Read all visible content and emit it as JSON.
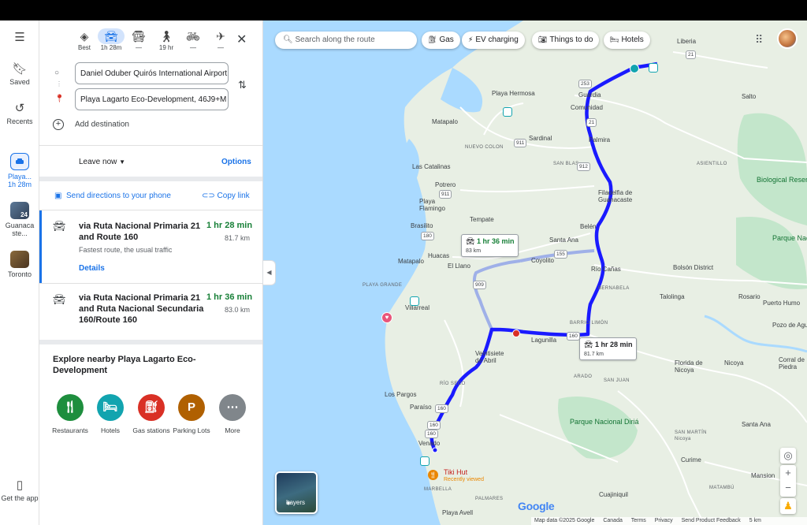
{
  "rail": {
    "menu_icon": "menu-icon",
    "saved": "Saved",
    "recents": "Recents",
    "active_label_line1": "Playa...",
    "active_label_line2": "1h 28m",
    "recent_1_label": "Guanaca ste...",
    "recent_1_count": "24",
    "recent_2_label": "Toronto",
    "get_app": "Get the app"
  },
  "modes": {
    "best": "Best",
    "drive": "1h 28m",
    "transit": "—",
    "walk": "19 hr",
    "bike": "—",
    "flight": "—"
  },
  "waypoints": {
    "origin": "Daniel Oduber Quirós International Airport",
    "destination": "Playa Lagarto Eco-Development, 46J9+M",
    "add_destination": "Add destination"
  },
  "timing": {
    "leave_now": "Leave now",
    "options": "Options"
  },
  "share": {
    "send_directions": "Send directions to your phone",
    "copy_link": "Copy link"
  },
  "routes": [
    {
      "name": "via Ruta Nacional Primaria 21 and Route 160",
      "duration": "1 hr 28 min",
      "distance": "81.7 km",
      "description": "Fastest route, the usual traffic",
      "details": "Details"
    },
    {
      "name": "via Ruta Nacional Primaria 21 and Ruta Nacional Secundaria 160/Route 160",
      "duration": "1 hr 36 min",
      "distance": "83.0 km"
    }
  ],
  "explore": {
    "title": "Explore nearby Playa Lagarto Eco-Development",
    "categories": [
      {
        "label": "Restaurants",
        "icon": "fork-knife-icon",
        "color": "#1e8e3e"
      },
      {
        "label": "Hotels",
        "icon": "bed-icon",
        "color": "#12a4af"
      },
      {
        "label": "Gas stations",
        "icon": "gas-pump-icon",
        "color": "#d93025"
      },
      {
        "label": "Parking Lots",
        "icon": "parking-icon",
        "color": "#b06000"
      },
      {
        "label": "More",
        "icon": "more-dots-icon",
        "color": "#80868b"
      }
    ]
  },
  "map": {
    "search_placeholder": "Search along the route",
    "chips": {
      "gas": "Gas",
      "ev": "EV charging",
      "things": "Things to do",
      "hotels": "Hotels"
    },
    "time_box_main": {
      "time": "1 hr 28 min",
      "dist": "81.7 km"
    },
    "time_box_alt": {
      "time": "1 hr 36 min",
      "dist": "83 km"
    },
    "labels": {
      "liberia": "Liberia",
      "playa_hermosa": "Playa Hermosa",
      "guardia": "Guardia",
      "comunidad": "Comunidad",
      "salto": "Salto",
      "matapalo_n": "Matapalo",
      "sardinal": "Sardinal",
      "palmira": "Palmira",
      "nuevo_colon": "NUEVO COLON",
      "las_catalinas": "Las Catalinas",
      "san_blas": "SAN BLAS",
      "asientillo": "ASIENTILLO",
      "potrero": "Potrero",
      "filadelfia": "Filadelfia de Guanacaste",
      "playa_flamingo": "Playa Flamingo",
      "tempate": "Tempate",
      "brasilito": "Brasilito",
      "belen": "Belén",
      "santa_ana": "Santa Ana",
      "huacas": "Huacas",
      "matapalo_s": "Matapalo",
      "el_llano": "El Llano",
      "coyolito": "Coyolito",
      "rio_canas": "Río Cañas",
      "bolson": "Bolsón District",
      "playa_grande": "PLAYA GRANDE",
      "bernabela": "BERNABELA",
      "talolinga": "Talolinga",
      "rosario": "Rosario",
      "puerto_humo": "Puerto Humo",
      "villarreal": "Villarreal",
      "barrio_limon": "BARRIO LIMÓN",
      "pozo_de_agua": "Pozo de Agu",
      "lagunilla": "Lagunilla",
      "veintisiete": "Veintisiete de Abril",
      "florida": "Florida de Nicoya",
      "nicoya": "Nicoya",
      "corral": "Corral de Piedra",
      "arado": "ARADO",
      "san_juan": "SAN JUAN",
      "los_pargos": "Los Pargos",
      "rio_seco": "RÍO SECO",
      "paraiso": "Paraíso",
      "santa_ana_s": "Santa Ana",
      "san_martin": "SAN MARTÍN Nicoya",
      "veinte": "Venado",
      "curime": "Curime",
      "mansion": "Mansion",
      "marbella": "MARBELLA",
      "palmares": "PALMARES",
      "cuajiniquil": "Cuajiniquil",
      "matambu": "MATAMBÚ",
      "playa_avellanas": "Playa Avell",
      "tiki_hut": "Tiki Hut",
      "tiki_hut_sub": "Recently viewed",
      "park_biological": "Biological Reserve Lomas Barbudal",
      "park_palo_verde": "Parque Nacional Palo Verde",
      "park_diria": "Parque Nacional Diriá"
    },
    "shields": [
      "21",
      "253",
      "21",
      "911",
      "912",
      "911",
      "180",
      "155",
      "909",
      "160",
      "160",
      "160",
      "160"
    ],
    "layers": "Layers",
    "logo": "Google",
    "attribution": {
      "data": "Map data ©2025 Google",
      "country": "Canada",
      "terms": "Terms",
      "privacy": "Privacy",
      "feedback": "Send Product Feedback",
      "scale": "5 km"
    },
    "colors": {
      "route_main": "#1a1aff",
      "route_alt": "#9fb0e8",
      "water": "#aadaff",
      "land": "#e8efe4",
      "park": "#c3e6cb"
    }
  }
}
